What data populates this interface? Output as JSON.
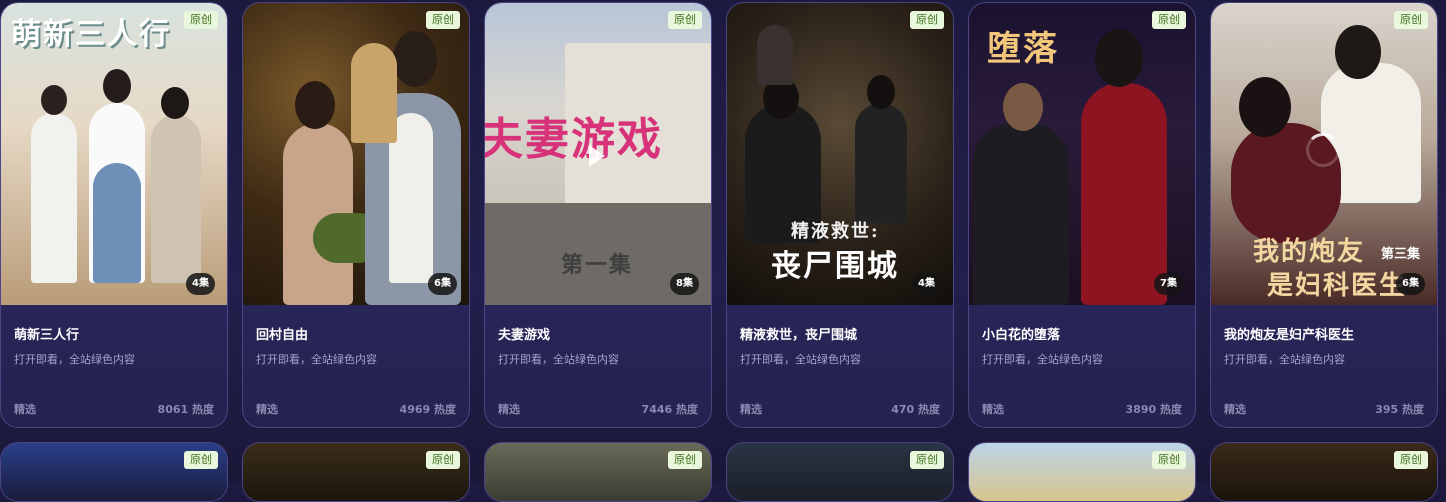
{
  "cards": [
    {
      "title": "萌新三人行",
      "desc": "打开即看，全站绿色内容",
      "badge": "原创",
      "episodes": "4集",
      "tag": "精选",
      "heat": "8061 热度",
      "poster_text": "萌新三人行"
    },
    {
      "title": "回村自由",
      "desc": "打开即看，全站绿色内容",
      "badge": "原创",
      "episodes": "6集",
      "tag": "精选",
      "heat": "4969 热度",
      "poster_text": ""
    },
    {
      "title": "夫妻游戏",
      "desc": "打开即看，全站绿色内容",
      "badge": "原创",
      "episodes": "8集",
      "tag": "精选",
      "heat": "7446 热度",
      "poster_text": "夫妻游戏",
      "poster_sub": "第一集"
    },
    {
      "title": "精液救世，丧尸围城",
      "desc": "打开即看，全站绿色内容",
      "badge": "原创",
      "episodes": "4集",
      "tag": "精选",
      "heat": "470 热度",
      "poster_text": "精液救世:",
      "poster_sub": "丧尸围城"
    },
    {
      "title": "小白花的堕落",
      "desc": "打开即看，全站绿色内容",
      "badge": "原创",
      "episodes": "7集",
      "tag": "精选",
      "heat": "3890 热度",
      "poster_text": "堕落"
    },
    {
      "title": "我的炮友是妇产科医生",
      "desc": "打开即看，全站绿色内容",
      "badge": "原创",
      "episodes": "6集",
      "tag": "精选",
      "heat": "395 热度",
      "poster_text": "我的炮友",
      "poster_sub": "是妇科医生",
      "poster_ep": "第三集"
    }
  ],
  "row2": [
    {
      "badge": "原创"
    },
    {
      "badge": "原创"
    },
    {
      "badge": "原创"
    },
    {
      "badge": "原创"
    },
    {
      "badge": "原创"
    },
    {
      "badge": "原创"
    }
  ],
  "icons": {
    "play": "play-icon",
    "loading": "loading-spinner-icon"
  }
}
